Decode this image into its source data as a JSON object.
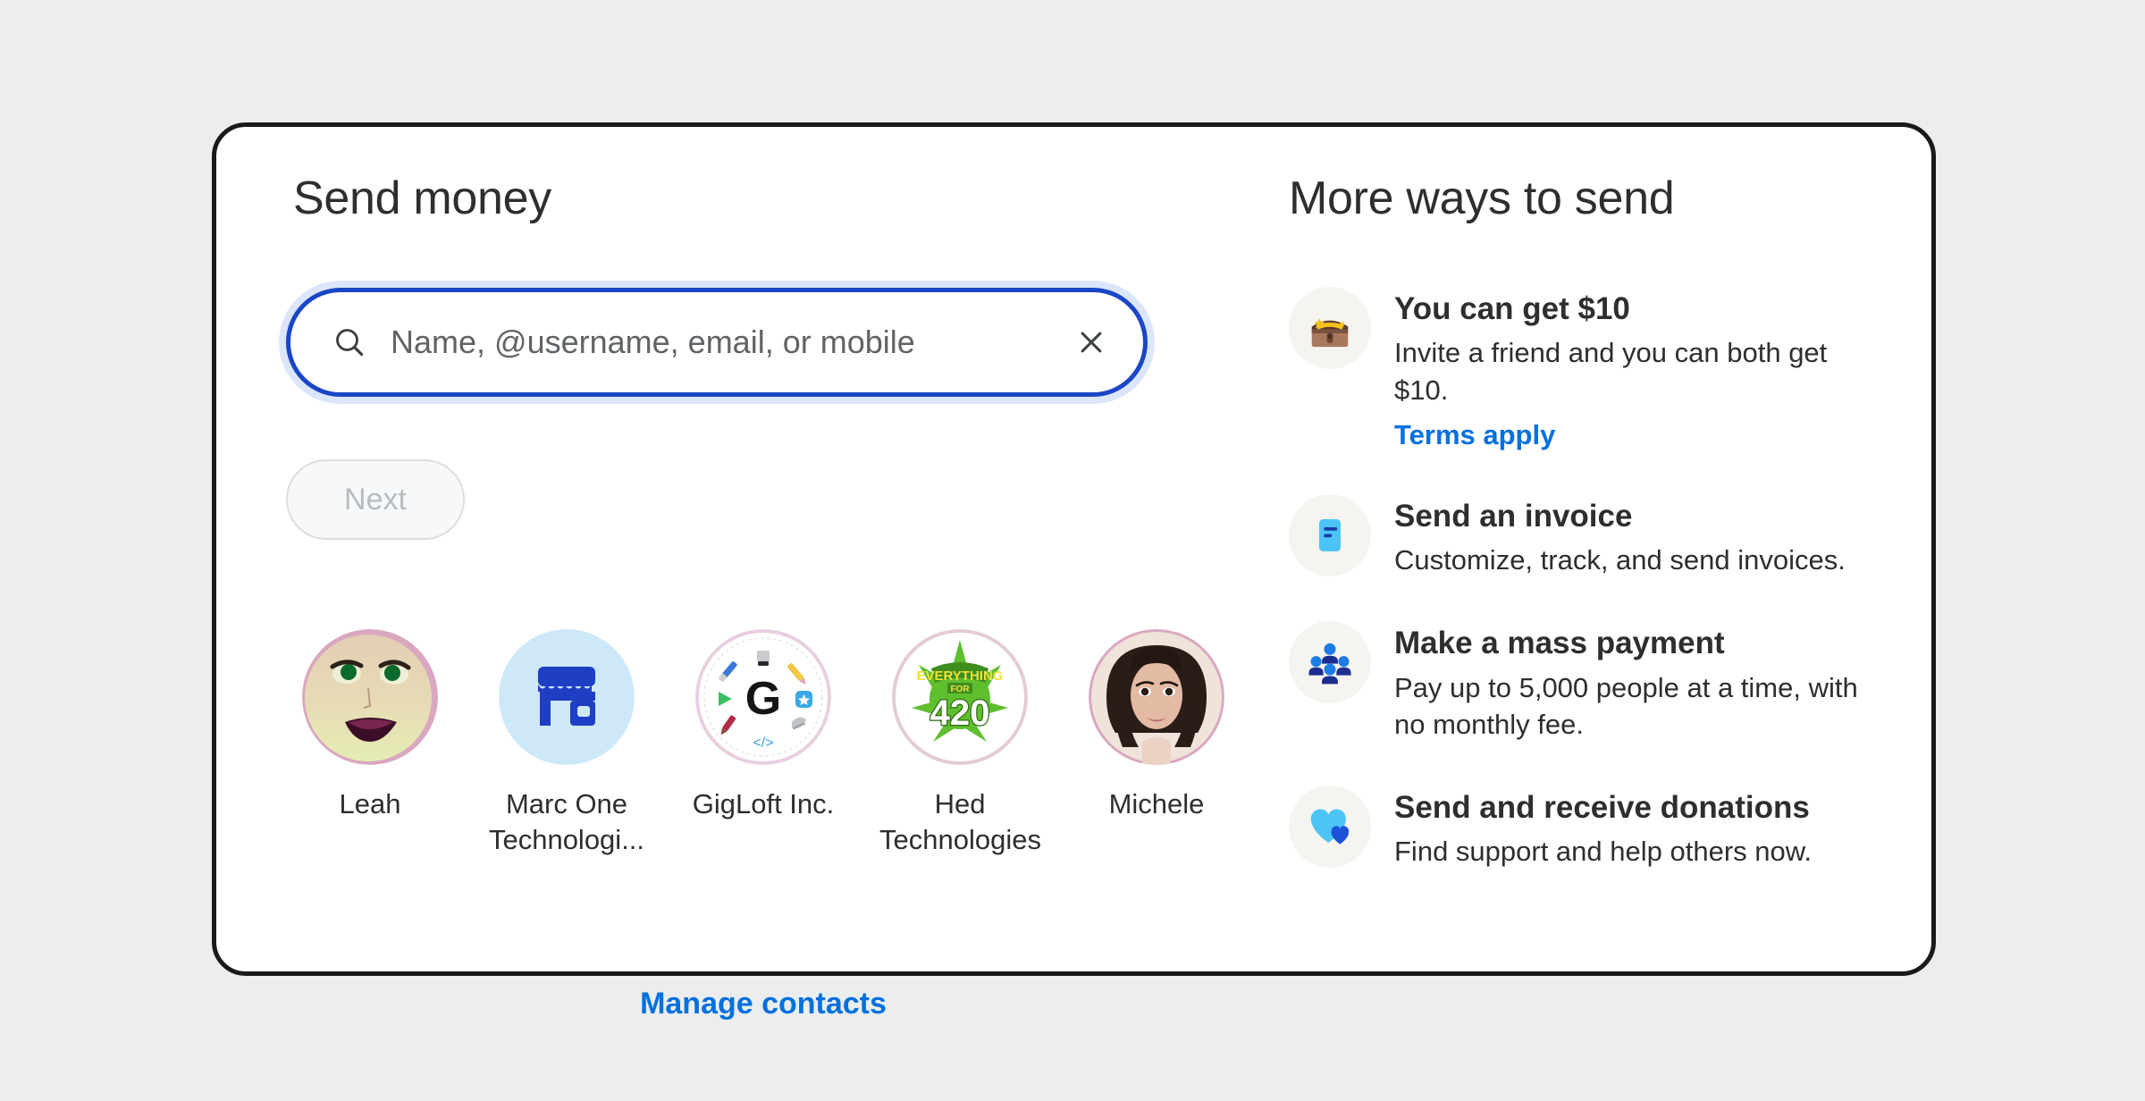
{
  "theme": {
    "page_background": "#ECEDEE",
    "card_background": "#FFFFFF",
    "card_border": "#1A1A1A",
    "accent_blue": "#0070E0",
    "focus_border": "#1A45C7",
    "focus_halo": "#DCE6FB",
    "text_primary": "#2C2E2F",
    "text_muted": "#5F6366",
    "disabled_text": "#B7BCC0",
    "icon_circle": "#F5F4F0"
  },
  "send_money": {
    "title": "Send money",
    "search": {
      "placeholder": "Name, @username, email, or mobile",
      "value": "",
      "search_icon": "search-icon",
      "clear_icon": "close-icon"
    },
    "next_button": {
      "label": "Next",
      "disabled": true
    },
    "contacts": [
      {
        "name": "Leah",
        "avatar_type": "photo-face"
      },
      {
        "name": "Marc One Technologi...",
        "avatar_type": "storefront-icon"
      },
      {
        "name": "GigLoft Inc.",
        "avatar_type": "giglolft-logo"
      },
      {
        "name": "Hed Technologies",
        "avatar_type": "everything-420-logo"
      },
      {
        "name": "Michele",
        "avatar_type": "photo-portrait"
      }
    ],
    "manage_contacts_label": "Manage contacts"
  },
  "more_ways": {
    "title": "More ways to send",
    "items": [
      {
        "icon": "treasure-chest-icon",
        "title": "You can get $10",
        "description": "Invite a friend and you can both get $10.",
        "link": "Terms apply"
      },
      {
        "icon": "invoice-document-icon",
        "title": "Send an invoice",
        "description": "Customize, track, and send invoices.",
        "link": ""
      },
      {
        "icon": "group-people-icon",
        "title": "Make a mass payment",
        "description": "Pay up to 5,000 people at a time, with no monthly fee.",
        "link": ""
      },
      {
        "icon": "hearts-icon",
        "title": "Send and receive donations",
        "description": "Find support and help others now.",
        "link": ""
      }
    ]
  }
}
